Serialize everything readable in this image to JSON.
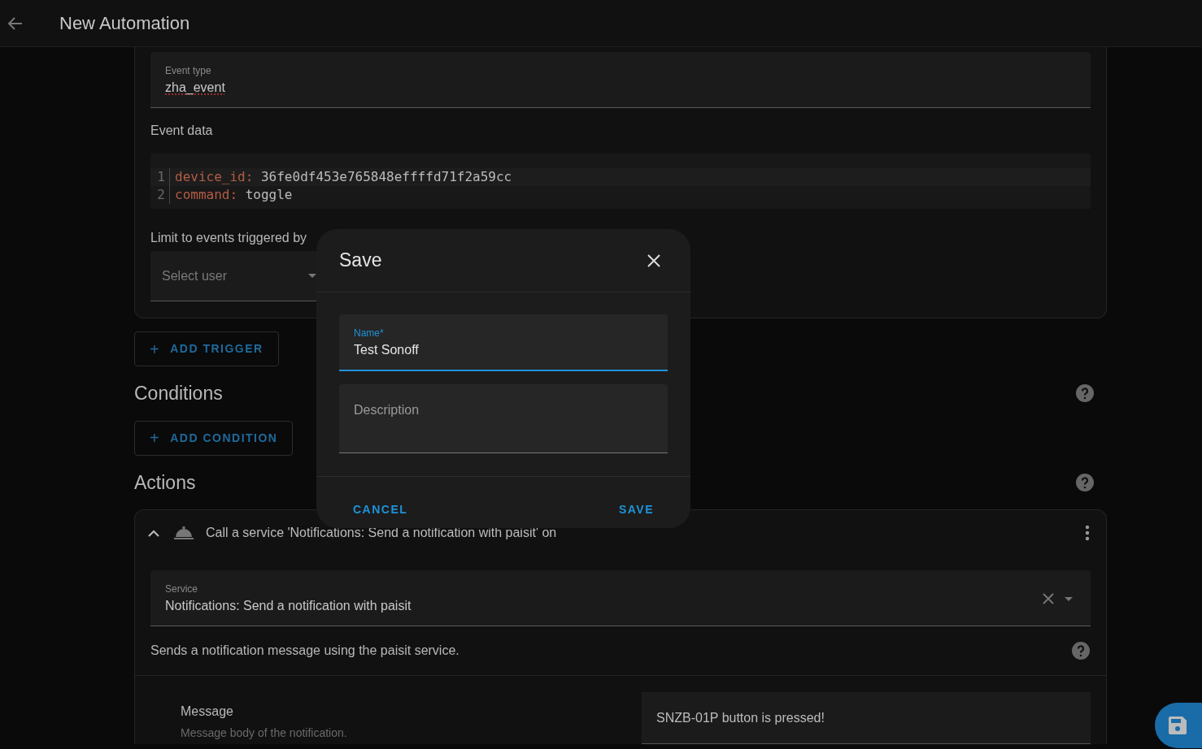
{
  "header": {
    "title": "New Automation"
  },
  "trigger": {
    "event_type": {
      "label": "Event type",
      "value": "zha_event"
    },
    "event_data_label": "Event data",
    "code_lines": [
      {
        "number": "1",
        "key": "device_id",
        "sep": ":",
        "value": " 36fe0df453e765848effffd71f2a59cc"
      },
      {
        "number": "2",
        "key": "command",
        "sep": ":",
        "value": " toggle"
      }
    ],
    "limit_label": "Limit to events triggered by",
    "user_select": {
      "placeholder": "Select user"
    }
  },
  "add_trigger": {
    "icon": "+",
    "label": "ADD TRIGGER"
  },
  "conditions": {
    "title": "Conditions",
    "add": {
      "icon": "+",
      "label": "ADD CONDITION"
    }
  },
  "actions": {
    "title": "Actions",
    "action": {
      "expanded": true,
      "title": "Call a service 'Notifications: Send a notification with paisit' on",
      "service": {
        "label": "Service",
        "value": "Notifications: Send a notification with paisit"
      },
      "description": "Sends a notification message using the paisit service.",
      "message": {
        "label": "Message",
        "hint": "Message body of the notification.",
        "value": "SNZB-01P button is pressed!"
      }
    }
  },
  "dialog": {
    "title": "Save",
    "name": {
      "label": "Name*",
      "value": "Test Sonoff",
      "focused": true
    },
    "description": {
      "placeholder": "Description"
    },
    "buttons": [
      {
        "label": "CANCEL"
      },
      {
        "label": "SAVE"
      }
    ]
  }
}
